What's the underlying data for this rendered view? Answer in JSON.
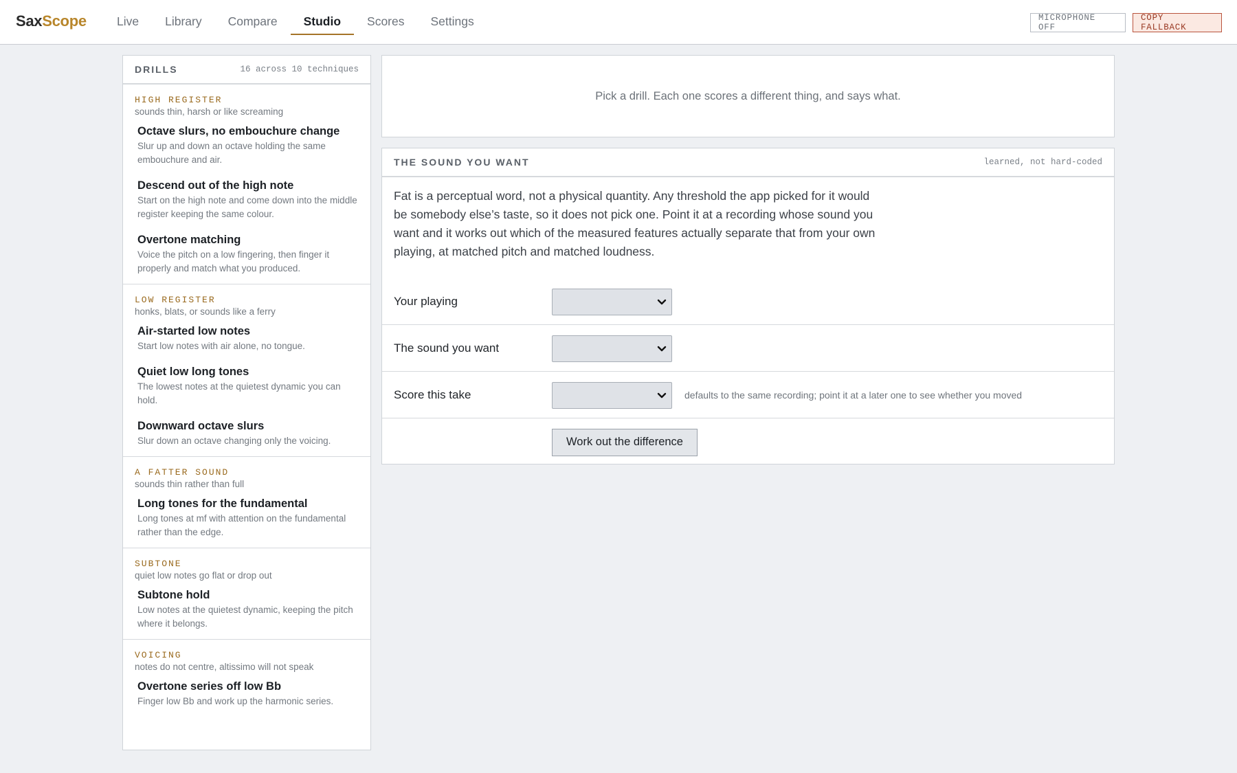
{
  "app": {
    "brand_part1": "Sax",
    "brand_part2": "Scope",
    "accent_color": "#b8862b"
  },
  "nav": {
    "items": [
      "Live",
      "Library",
      "Compare",
      "Studio",
      "Scores",
      "Settings"
    ],
    "active": "Studio"
  },
  "toolbar": {
    "microphone_label": "MICROPHONE OFF",
    "copy_fallback_label": "COPY FALLBACK"
  },
  "sidebar": {
    "title": "DRILLS",
    "count": "16 across 10 techniques",
    "groups": [
      {
        "name": "HIGH REGISTER",
        "description": "sounds thin, harsh or like screaming",
        "drills": [
          {
            "title": "Octave slurs, no embouchure change",
            "description": "Slur up and down an octave holding the same embouchure and air."
          },
          {
            "title": "Descend out of the high note",
            "description": "Start on the high note and come down into the middle register keeping the same colour."
          },
          {
            "title": "Overtone matching",
            "description": "Voice the pitch on a low fingering, then finger it properly and match what you produced."
          }
        ]
      },
      {
        "name": "LOW REGISTER",
        "description": "honks, blats, or sounds like a ferry",
        "drills": [
          {
            "title": "Air-started low notes",
            "description": "Start low notes with air alone, no tongue."
          },
          {
            "title": "Quiet low long tones",
            "description": "The lowest notes at the quietest dynamic you can hold."
          },
          {
            "title": "Downward octave slurs",
            "description": "Slur down an octave changing only the voicing."
          }
        ]
      },
      {
        "name": "A FATTER SOUND",
        "description": "sounds thin rather than full",
        "drills": [
          {
            "title": "Long tones for the fundamental",
            "description": "Long tones at mf with attention on the fundamental rather than the edge."
          }
        ]
      },
      {
        "name": "SUBTONE",
        "description": "quiet low notes go flat or drop out",
        "drills": [
          {
            "title": "Subtone hold",
            "description": "Low notes at the quietest dynamic, keeping the pitch where it belongs."
          }
        ]
      },
      {
        "name": "VOICING",
        "description": "notes do not centre, altissimo will not speak",
        "drills": [
          {
            "title": "Overtone series off low Bb",
            "description": "Finger low Bb and work up the harmonic series."
          }
        ]
      }
    ]
  },
  "intro": {
    "text": "Pick a drill. Each one scores a different thing, and says what."
  },
  "sound_panel": {
    "title": "THE SOUND YOU WANT",
    "note": "learned, not hard-coded",
    "body": "Fat is a perceptual word, not a physical quantity. Any threshold the app picked for it would be somebody else’s taste, so it does not pick one. Point it at a recording whose sound you want and it works out which of the measured features actually separate that from your own playing, at matched pitch and matched loudness.",
    "your_playing_label": "Your playing",
    "sound_you_want_label": "The sound you want",
    "score_take_label": "Score this take",
    "score_take_hint": "defaults to the same recording; point it at a later one to see whether you moved",
    "submit_label": "Work out the difference"
  }
}
